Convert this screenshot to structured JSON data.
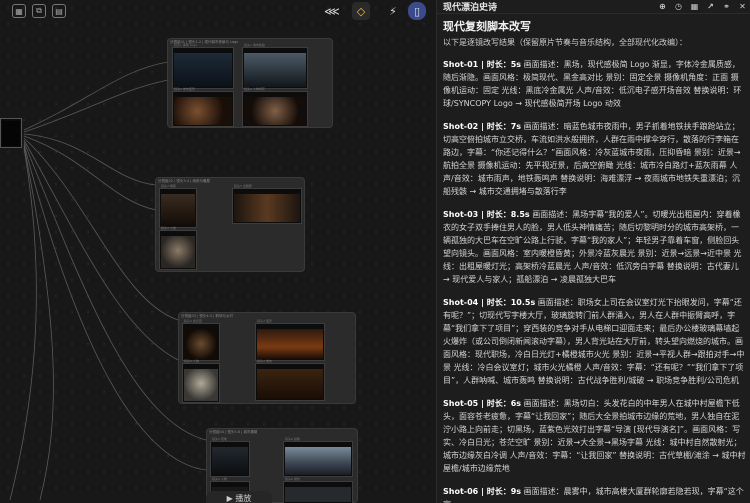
{
  "toolbar": {
    "right_icons": [
      "share-icon",
      "theme-icon",
      "lightning-icon",
      "book-icon"
    ]
  },
  "left_tools": [
    "grid-icon",
    "split-icon",
    "layout-icon"
  ],
  "bottom_control": {
    "play_label": "▶ 播放"
  },
  "groups": [
    {
      "label": "分镜组01 | 镜头1-2 | 现代城市夜景与 Logo"
    },
    {
      "label": "分镜组02 | 镜头3-4 | 雨夜与暖屋"
    },
    {
      "label": "分镜组03 | 镜头4-5 | 职场与乡村"
    },
    {
      "label": "分镜组04 | 镜头5-6 | 城市晨曦"
    }
  ],
  "thumbs": [
    {
      "cap": "镜头1 黑场 Logo"
    },
    {
      "cap": "镜头1 城市航拍"
    },
    {
      "cap": "镜头2 城市夜景"
    },
    {
      "cap": "镜头2 人物特写"
    },
    {
      "cap": "镜头3 暗巷"
    },
    {
      "cap": "镜头3 出租屋"
    },
    {
      "cap": "镜头3 人物"
    },
    {
      "cap": "镜头4 会议室"
    },
    {
      "cap": "镜头4 夜景"
    },
    {
      "cap": "镜头4 人物"
    },
    {
      "cap": "镜头4 城市"
    },
    {
      "cap": "镜头5 荒地"
    },
    {
      "cap": "镜头5 人物"
    },
    {
      "cap": "镜头6 晨曦"
    },
    {
      "cap": "镜头6 城市"
    }
  ],
  "panel": {
    "title": "现代漂泊史诗",
    "icons": [
      "plus-icon",
      "clock-icon",
      "grid-icon",
      "share-icon",
      "link-icon",
      "close-icon"
    ],
    "heading": "现代复刻脚本改写",
    "intro": "以下是逐镜改写结果（保留原片节奏与音乐结构，全部现代化改编）：",
    "shots": [
      {
        "title": "Shot-01 | 时长：5s",
        "text": " 画面描述：黑场，现代感极简 Logo 渐显，字体冷金属质感，随后渐隐。画面风格：极简现代、黑金高对比 景别：固定全景 摄像机角度：正面 摄像机运动：固定 光线：黑底冷金属光 人声/音效：低沉电子感开场音效 替换说明：环球/SYNCOPY Logo → 现代感极简开场 Logo 动效"
      },
      {
        "title": "Shot-02 | 时长：7s",
        "text": " 画面描述：暗蓝色城市夜雨中，男子抓着地铁扶手踉跄站立；切高空俯拍城市立交桥，车流如洪水般拥挤，人群在雨中撑伞穿行，散落的行李箱在路边，字幕：“你还记得什么？”画面风格：冷灰蓝城市夜雨，压抑昏暗 景别：近景→航拍全景 摄像机运动：先平视近景，后高空俯瞰 光线：城市冷白路灯+蓝灰雨幕 人声/音效：城市雨声，地铁轰鸣声 替换说明：海难漂浮 → 夜雨城市地铁失重漂泊；沉船残骸 → 城市交通拥堵与散落行李"
      },
      {
        "title": "Shot-03 | 时长：8.5s",
        "text": " 画面描述：黑场字幕“我的爱人”。切暖光出租屋内：穿着橡衣的女子双手捧住男人的脸，男人低头神情痛苦；随后切黎明时分的城市高架桥，一辆孤独的大巴车在空旷公路上行驶，字幕“我的家人”；年轻男子靠着车窗，侧脸回头望向镜头。画面风格：室内暖橙昏黄；外景冷蓝灰晨光 景别：近景→远景→近中景 光线：出租屋暖灯光；高架桥冷蓝晨光 人声/音效：低沉旁白字幕 替换说明：古代妻儿 → 现代爱人与家人；孤船漂泊 → 凌晨孤独大巴车"
      },
      {
        "title": "Shot-04 | 时长：10.5s",
        "text": " 画面描述：职场女上司在会议室灯光下抬眼发问，字幕“还有呢？”；切现代写字楼大厅，玻璃旋转门前人群涌入，男人在人群中振臂高呼，字幕“我们拿下了项目”；穿西装的竞争对手从电梯口迎面走来；最后办公楼玻璃幕墙起火爆炸（或公司倒闭新闻滚动字幕），男人背光站在大厅前，转头望向燃烧的城市。画面风格：现代职场，冷白日光灯+橘橙城市火光 景别：近景→平视人群→跟拍对手→中景 光线：冷白会议室灯；城市火光橘橙 人声/音效：字幕：“还有呢？”“我们拿下了项目”，人群呐喊、城市轰鸣 替换说明：古代战争胜利/城破 → 职场竞争胜利/公司危机"
      },
      {
        "title": "Shot-05 | 时长：6s",
        "text": " 画面描述：黑场切白：头发花白的中年男人在城中村屋檐下低头，面容苍老疲惫，字幕“让我回家”；随后大全景拍城市边缘的荒地，男人独自在泥泞小路上向前走；切黑场，蓝紫色光效打出字幕“导演 [现代导演名]”。画面风格：写实、冷白日光；苍茫空旷 景别：近景→大全景→黑场字幕 光线：城中村自然散射光；城市边缘灰白冷调 人声/音效：字幕：“让我回家” 替换说明：古代草棚/滩涂 → 城中村屋檐/城市边缘荒地"
      },
      {
        "title": "Shot-06 | 时长：9s",
        "text": " 画面描述：晨雾中，城市高楼大厦群轮廓若隐若现，字幕“这个家，"
      }
    ]
  }
}
